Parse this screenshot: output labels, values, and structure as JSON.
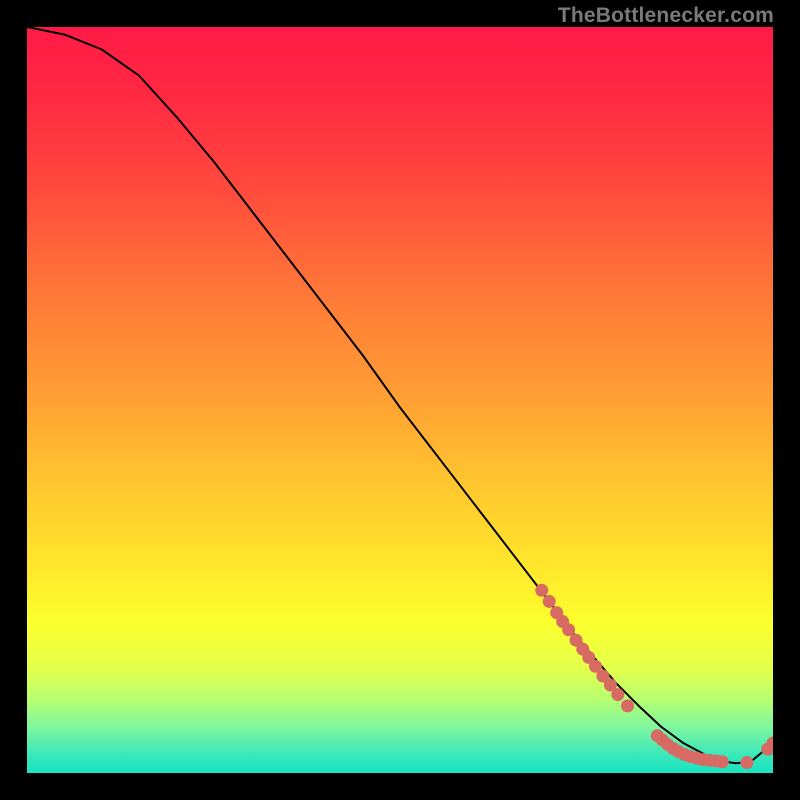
{
  "watermark": "TheBottlenecker.com",
  "colors": {
    "dot": "#d76a63",
    "line": "#000000",
    "gradient_stops": [
      {
        "offset": 0.0,
        "color": "#ff1a46"
      },
      {
        "offset": 0.1,
        "color": "#ff2b42"
      },
      {
        "offset": 0.22,
        "color": "#ff4b3d"
      },
      {
        "offset": 0.35,
        "color": "#ff7638"
      },
      {
        "offset": 0.48,
        "color": "#ff9a34"
      },
      {
        "offset": 0.6,
        "color": "#ffc22f"
      },
      {
        "offset": 0.72,
        "color": "#ffe62b"
      },
      {
        "offset": 0.8,
        "color": "#fbff2d"
      },
      {
        "offset": 0.86,
        "color": "#e3ff4a"
      },
      {
        "offset": 0.9,
        "color": "#b8ff70"
      },
      {
        "offset": 0.94,
        "color": "#7cf6a0"
      },
      {
        "offset": 0.975,
        "color": "#3be8ba"
      },
      {
        "offset": 1.0,
        "color": "#17e3c0"
      }
    ]
  },
  "chart_data": {
    "type": "line",
    "xlabel": "",
    "ylabel": "",
    "title": "",
    "xlim": [
      0,
      100
    ],
    "ylim": [
      0,
      100
    ],
    "series": [
      {
        "name": "curve",
        "x": [
          0,
          5,
          10,
          15,
          20,
          25,
          30,
          35,
          40,
          45,
          50,
          55,
          60,
          65,
          70,
          73,
          76,
          79,
          82,
          85,
          88,
          91,
          93,
          95,
          97,
          100
        ],
        "y": [
          100,
          99,
          97,
          93.5,
          88,
          82,
          75.5,
          69,
          62.5,
          56,
          49,
          42.5,
          36,
          29.5,
          23,
          19,
          15.5,
          12,
          9,
          6.2,
          4.0,
          2.4,
          1.6,
          1.3,
          1.5,
          4.0
        ]
      }
    ],
    "markers": [
      {
        "x": 69.0,
        "y": 24.5
      },
      {
        "x": 70.0,
        "y": 23.0
      },
      {
        "x": 71.0,
        "y": 21.5
      },
      {
        "x": 71.8,
        "y": 20.3
      },
      {
        "x": 72.6,
        "y": 19.2
      },
      {
        "x": 73.6,
        "y": 17.8
      },
      {
        "x": 74.5,
        "y": 16.6
      },
      {
        "x": 75.3,
        "y": 15.5
      },
      {
        "x": 76.2,
        "y": 14.3
      },
      {
        "x": 77.2,
        "y": 13.0
      },
      {
        "x": 78.2,
        "y": 11.8
      },
      {
        "x": 79.2,
        "y": 10.5
      },
      {
        "x": 80.5,
        "y": 9.0
      },
      {
        "x": 84.5,
        "y": 5.0
      },
      {
        "x": 85.2,
        "y": 4.4
      },
      {
        "x": 85.9,
        "y": 3.8
      },
      {
        "x": 86.6,
        "y": 3.3
      },
      {
        "x": 87.3,
        "y": 2.9
      },
      {
        "x": 88.1,
        "y": 2.5
      },
      {
        "x": 88.9,
        "y": 2.2
      },
      {
        "x": 89.8,
        "y": 2.0
      },
      {
        "x": 90.6,
        "y": 1.8
      },
      {
        "x": 91.5,
        "y": 1.7
      },
      {
        "x": 92.4,
        "y": 1.6
      },
      {
        "x": 93.2,
        "y": 1.5
      },
      {
        "x": 96.5,
        "y": 1.4
      },
      {
        "x": 99.3,
        "y": 3.2
      },
      {
        "x": 100.0,
        "y": 4.0
      }
    ]
  }
}
